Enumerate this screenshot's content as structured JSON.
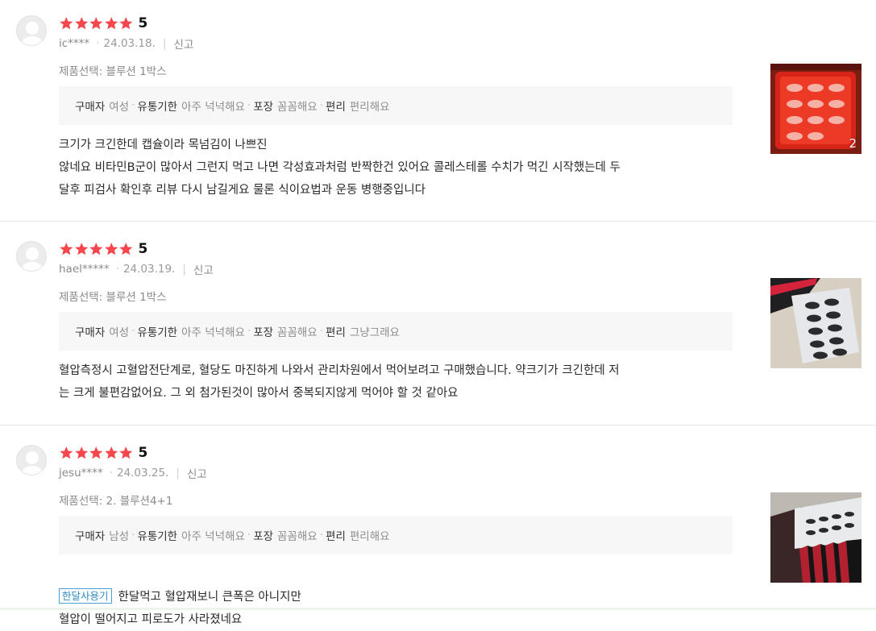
{
  "reviews": [
    {
      "stars": 5,
      "score": "5",
      "user": "ic****",
      "date": "24.03.18.",
      "report": "신고",
      "option_label": "제품선택: 블루션 1박스",
      "attrs": [
        {
          "key": "구매자",
          "value": "여성"
        },
        {
          "key": "유통기한",
          "value": "아주 넉넉해요"
        },
        {
          "key": "포장",
          "value": "꼼꼼해요"
        },
        {
          "key": "편리",
          "value": "편리해요"
        }
      ],
      "tag": "",
      "text": "크기가 크긴한데 캡슐이라 목넘김이 나쁘진\n않네요 비타민B군이 많아서 그런지 먹고 나면 각성효과처럼 반짝한건 있어요 콜레스테롤 수치가 먹긴 시작했는데 두\n달후 피검사 확인후 리뷰 다시 남길게요 물론 식이요법과 운동 병행중입니다",
      "image_count": "2",
      "photo_icon": "blister-pack-photo"
    },
    {
      "stars": 5,
      "score": "5",
      "user": "hael*****",
      "date": "24.03.19.",
      "report": "신고",
      "option_label": "제품선택: 블루션 1박스",
      "attrs": [
        {
          "key": "구매자",
          "value": "여성"
        },
        {
          "key": "유통기한",
          "value": "아주 넉넉해요"
        },
        {
          "key": "포장",
          "value": "꼼꼼해요"
        },
        {
          "key": "편리",
          "value": "그냥그래요"
        }
      ],
      "tag": "",
      "text": "혈압측정시 고혈압전단계로, 혈당도 마진하게 나와서 관리차원에서 먹어보려고 구매했습니다. 약크기가 크긴한데 저\n는 크게 불편감없어요. 그 외 첨가된것이 많아서 중복되지않게 먹어야 할 것 같아요",
      "image_count": "",
      "photo_icon": "capsule-blister-photo"
    },
    {
      "stars": 5,
      "score": "5",
      "user": "jesu****",
      "date": "24.03.25.",
      "report": "신고",
      "option_label": "제품선택: 2. 블루션4+1",
      "attrs": [
        {
          "key": "구매자",
          "value": "남성"
        },
        {
          "key": "유통기한",
          "value": "아주 넉넉해요"
        },
        {
          "key": "포장",
          "value": "꼼꼼해요"
        },
        {
          "key": "편리",
          "value": "편리해요"
        }
      ],
      "tag": "한달사용기",
      "text": "한달먹고 혈압재보니 큰폭은 아니지만\n혈압이 떨어지고 피로도가 사라졌네요",
      "image_count": "",
      "photo_icon": "product-boxes-photo"
    }
  ],
  "colors": {
    "star": "#f5474d",
    "attr_bg": "#f7f7f8",
    "tag_border": "#4aa3d6",
    "divider": "#e5e5e5"
  }
}
